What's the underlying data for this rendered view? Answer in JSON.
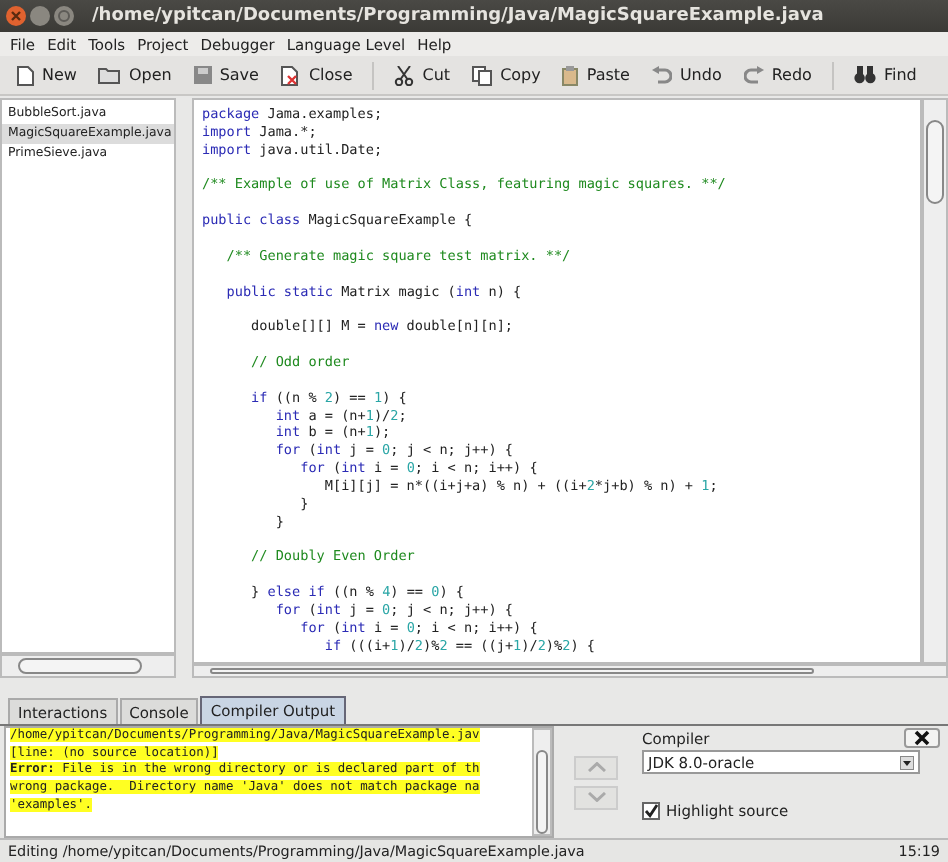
{
  "window": {
    "title": "/home/ypitcan/Documents/Programming/Java/MagicSquareExample.java"
  },
  "menu": [
    "File",
    "Edit",
    "Tools",
    "Project",
    "Debugger",
    "Language Level",
    "Help"
  ],
  "toolbar": [
    {
      "label": "New"
    },
    {
      "label": "Open"
    },
    {
      "label": "Save"
    },
    {
      "label": "Close"
    },
    {
      "label": "Cut"
    },
    {
      "label": "Copy"
    },
    {
      "label": "Paste"
    },
    {
      "label": "Undo"
    },
    {
      "label": "Redo"
    },
    {
      "label": "Find"
    }
  ],
  "files": [
    {
      "name": "BubbleSort.java",
      "selected": false
    },
    {
      "name": "MagicSquareExample.java",
      "selected": true
    },
    {
      "name": "PrimeSieve.java",
      "selected": false
    }
  ],
  "editor": {
    "lines": [
      {
        "tokens": [
          {
            "text": "package",
            "kind": "keyword"
          },
          {
            "text": " Jama.examples;",
            "kind": "plain"
          }
        ]
      },
      {
        "tokens": [
          {
            "text": "import",
            "kind": "keyword"
          },
          {
            "text": " Jama.*;",
            "kind": "plain"
          }
        ]
      },
      {
        "tokens": [
          {
            "text": "import",
            "kind": "keyword"
          },
          {
            "text": " java.util.Date;",
            "kind": "plain"
          }
        ]
      },
      {
        "blank_before": true,
        "tokens": [
          {
            "text": "/** Example of use of Matrix Class, featuring magic squares. **/",
            "kind": "comment"
          }
        ]
      },
      {
        "blank_before": true,
        "tokens": [
          {
            "text": "public class",
            "kind": "keyword"
          },
          {
            "text": " MagicSquareExample {",
            "kind": "plain"
          }
        ]
      },
      {
        "blank_before": true,
        "tokens": [
          {
            "text": "   /** Generate magic square test matrix. **/",
            "kind": "comment"
          }
        ]
      },
      {
        "blank_before": true,
        "tokens": [
          {
            "text": "   public static",
            "kind": "keyword"
          },
          {
            "text": " Matrix magic (",
            "kind": "plain"
          },
          {
            "text": "int",
            "kind": "keyword"
          },
          {
            "text": " n) {",
            "kind": "plain"
          }
        ]
      },
      {
        "blank_before": true,
        "tokens": [
          {
            "text": "      double[][] M = ",
            "kind": "plain"
          },
          {
            "text": "new",
            "kind": "keyword"
          },
          {
            "text": " double[n][n];",
            "kind": "plain"
          }
        ]
      },
      {
        "blank_before": true,
        "tokens": [
          {
            "text": "      // Odd order",
            "kind": "comment"
          }
        ]
      },
      {
        "blank_before": true,
        "tokens": [
          {
            "text": "      if",
            "kind": "keyword"
          },
          {
            "text": " ((n % ",
            "kind": "plain"
          },
          {
            "text": "2",
            "kind": "number"
          },
          {
            "text": ") == ",
            "kind": "plain"
          },
          {
            "text": "1",
            "kind": "number"
          },
          {
            "text": ") {",
            "kind": "plain"
          }
        ]
      },
      {
        "tokens": [
          {
            "text": "         int",
            "kind": "keyword"
          },
          {
            "text": " a = (n+",
            "kind": "plain"
          },
          {
            "text": "1",
            "kind": "number"
          },
          {
            "text": ")/",
            "kind": "plain"
          },
          {
            "text": "2",
            "kind": "number"
          },
          {
            "text": ";",
            "kind": "plain"
          }
        ]
      },
      {
        "tokens": [
          {
            "text": "         int",
            "kind": "keyword"
          },
          {
            "text": " b = (n+",
            "kind": "plain"
          },
          {
            "text": "1",
            "kind": "number"
          },
          {
            "text": ");",
            "kind": "plain"
          }
        ]
      },
      {
        "tokens": [
          {
            "text": "         for",
            "kind": "keyword"
          },
          {
            "text": " (",
            "kind": "plain"
          },
          {
            "text": "int",
            "kind": "keyword"
          },
          {
            "text": " j = ",
            "kind": "plain"
          },
          {
            "text": "0",
            "kind": "number"
          },
          {
            "text": "; j < n; j++) {",
            "kind": "plain"
          }
        ]
      },
      {
        "tokens": [
          {
            "text": "            for",
            "kind": "keyword"
          },
          {
            "text": " (",
            "kind": "plain"
          },
          {
            "text": "int",
            "kind": "keyword"
          },
          {
            "text": " i = ",
            "kind": "plain"
          },
          {
            "text": "0",
            "kind": "number"
          },
          {
            "text": "; i < n; i++) {",
            "kind": "plain"
          }
        ]
      },
      {
        "tokens": [
          {
            "text": "               M[i][j] = n*((i+j+a) % n) + ((i+",
            "kind": "plain"
          },
          {
            "text": "2",
            "kind": "number"
          },
          {
            "text": "*j+b) % n) + ",
            "kind": "plain"
          },
          {
            "text": "1",
            "kind": "number"
          },
          {
            "text": ";",
            "kind": "plain"
          }
        ]
      },
      {
        "tokens": [
          {
            "text": "            }",
            "kind": "plain"
          }
        ]
      },
      {
        "tokens": [
          {
            "text": "         }",
            "kind": "plain"
          }
        ]
      },
      {
        "blank_before": true,
        "tokens": [
          {
            "text": "      // Doubly Even Order",
            "kind": "comment"
          }
        ]
      },
      {
        "blank_before": true,
        "tokens": [
          {
            "text": "      } ",
            "kind": "plain"
          },
          {
            "text": "else if",
            "kind": "keyword"
          },
          {
            "text": " ((n % ",
            "kind": "plain"
          },
          {
            "text": "4",
            "kind": "number"
          },
          {
            "text": ") == ",
            "kind": "plain"
          },
          {
            "text": "0",
            "kind": "number"
          },
          {
            "text": ") {",
            "kind": "plain"
          }
        ]
      },
      {
        "tokens": [
          {
            "text": "         for",
            "kind": "keyword"
          },
          {
            "text": " (",
            "kind": "plain"
          },
          {
            "text": "int",
            "kind": "keyword"
          },
          {
            "text": " j = ",
            "kind": "plain"
          },
          {
            "text": "0",
            "kind": "number"
          },
          {
            "text": "; j < n; j++) {",
            "kind": "plain"
          }
        ]
      },
      {
        "tokens": [
          {
            "text": "            for",
            "kind": "keyword"
          },
          {
            "text": " (",
            "kind": "plain"
          },
          {
            "text": "int",
            "kind": "keyword"
          },
          {
            "text": " i = ",
            "kind": "plain"
          },
          {
            "text": "0",
            "kind": "number"
          },
          {
            "text": "; i < n; i++) {",
            "kind": "plain"
          }
        ]
      },
      {
        "tokens": [
          {
            "text": "               if",
            "kind": "keyword"
          },
          {
            "text": " (((i+",
            "kind": "plain"
          },
          {
            "text": "1",
            "kind": "number"
          },
          {
            "text": ")/",
            "kind": "plain"
          },
          {
            "text": "2",
            "kind": "number"
          },
          {
            "text": ")%",
            "kind": "plain"
          },
          {
            "text": "2",
            "kind": "number"
          },
          {
            "text": " == ((j+",
            "kind": "plain"
          },
          {
            "text": "1",
            "kind": "number"
          },
          {
            "text": ")/",
            "kind": "plain"
          },
          {
            "text": "2",
            "kind": "number"
          },
          {
            "text": ")%",
            "kind": "plain"
          },
          {
            "text": "2",
            "kind": "number"
          },
          {
            "text": ") {",
            "kind": "plain"
          }
        ]
      }
    ]
  },
  "tabs": [
    {
      "label": "Interactions",
      "selected": false
    },
    {
      "label": "Console",
      "selected": false
    },
    {
      "label": "Compiler Output",
      "selected": true
    }
  ],
  "output": {
    "lines": [
      "/home/ypitcan/Documents/Programming/Java/MagicSquareExample.jav",
      "[line: (no source location)]",
      "**Error:** File is in the wrong directory or is declared part of th",
      "wrong package.  Directory name 'Java' does not match package na",
      "'examples'."
    ],
    "previous_disabled": true,
    "next_disabled": true
  },
  "compiler": {
    "label": "Compiler",
    "value": "JDK 8.0-oracle",
    "highlight_label": "Highlight source",
    "highlight_checked": true
  },
  "status_bar": {
    "text": "Editing /home/ypitcan/Documents/Programming/Java/MagicSquareExample.java",
    "position": "15:19"
  }
}
